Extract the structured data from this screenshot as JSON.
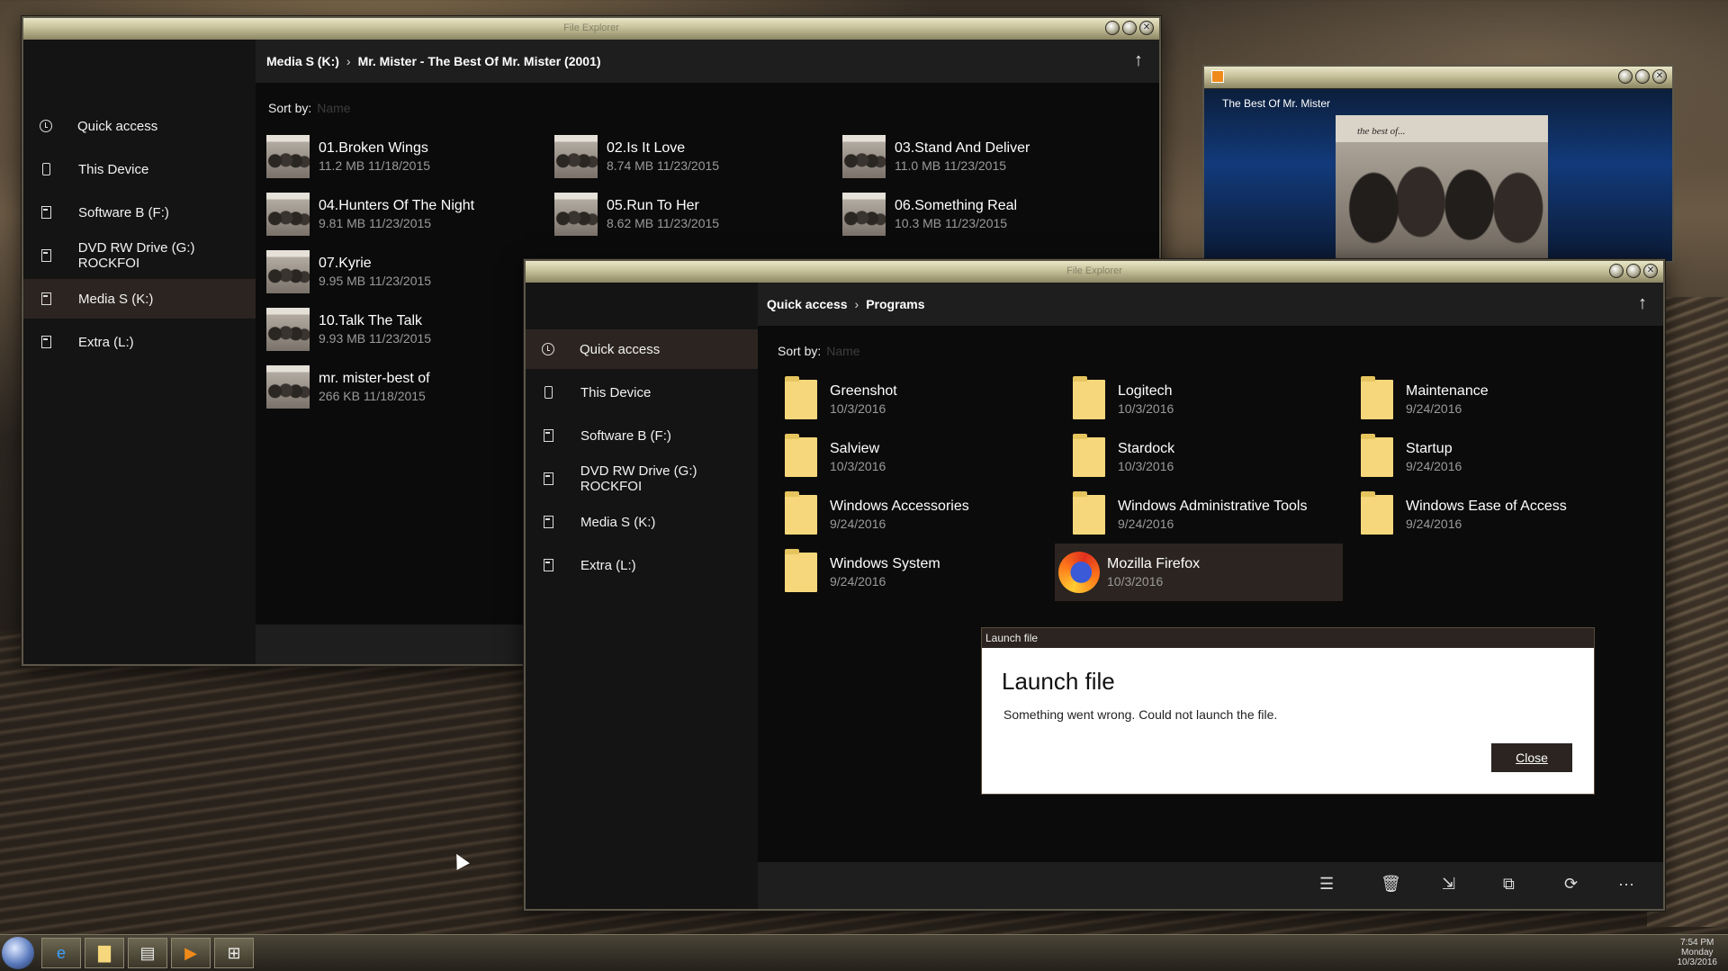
{
  "win1": {
    "title": "File Explorer",
    "breadcrumb": [
      "Media S (K:)",
      "Mr. Mister - The Best Of Mr. Mister (2001)"
    ],
    "sort_label": "Sort by:",
    "sort_placeholder": "Name",
    "sidebar": [
      "Quick access",
      "This Device",
      "Software B (F:)",
      "DVD RW Drive (G:) ROCKFOI",
      "Media S (K:)",
      "Extra (L:)"
    ],
    "files": [
      {
        "name": "01.Broken Wings",
        "meta": "11.2 MB 11/18/2015"
      },
      {
        "name": "02.Is It Love",
        "meta": "8.74 MB 11/23/2015"
      },
      {
        "name": "03.Stand And Deliver",
        "meta": "11.0 MB 11/23/2015"
      },
      {
        "name": "04.Hunters Of The Night",
        "meta": "9.81 MB 11/23/2015"
      },
      {
        "name": "05.Run To Her",
        "meta": "8.62 MB 11/23/2015"
      },
      {
        "name": "06.Something Real",
        "meta": "10.3 MB 11/23/2015"
      },
      {
        "name": "07.Kyrie",
        "meta": "9.95 MB 11/23/2015"
      },
      {
        "name": "10.Talk The Talk",
        "meta": "9.93 MB 11/23/2015"
      },
      {
        "name": "mr. mister-best of",
        "meta": "266 KB 11/18/2015"
      }
    ]
  },
  "player": {
    "title": "The Best Of Mr. Mister",
    "album_text": "the best of..."
  },
  "win2": {
    "title": "File Explorer",
    "breadcrumb": [
      "Quick access",
      "Programs"
    ],
    "sort_label": "Sort by:",
    "sort_placeholder": "Name",
    "sidebar": [
      "Quick access",
      "This Device",
      "Software B (F:)",
      "DVD RW Drive (G:) ROCKFOI",
      "Media S (K:)",
      "Extra (L:)"
    ],
    "items": [
      {
        "name": "Greenshot",
        "date": "10/3/2016"
      },
      {
        "name": "Logitech",
        "date": "10/3/2016"
      },
      {
        "name": "Maintenance",
        "date": "9/24/2016"
      },
      {
        "name": "Salview",
        "date": "10/3/2016"
      },
      {
        "name": "Stardock",
        "date": "10/3/2016"
      },
      {
        "name": "Startup",
        "date": "9/24/2016"
      },
      {
        "name": "Windows Accessories",
        "date": "9/24/2016"
      },
      {
        "name": "Windows Administrative Tools",
        "date": "9/24/2016"
      },
      {
        "name": "Windows Ease of Access",
        "date": "9/24/2016"
      },
      {
        "name": "Windows System",
        "date": "9/24/2016"
      },
      {
        "name": "Mozilla Firefox",
        "date": "10/3/2016"
      }
    ],
    "cmd_more": "···"
  },
  "dialog": {
    "header": "Launch file",
    "title": "Launch file",
    "message": "Something went wrong. Could not launch the file.",
    "close_label": "Close"
  },
  "taskbar": {
    "time": "7:54 PM",
    "day": "Monday",
    "date": "10/3/2016"
  },
  "colors": {
    "accent": "#2b2420",
    "folder": "#f6d77b",
    "window_bg": "#0b0b0b",
    "sidebar_bg": "#141414"
  }
}
